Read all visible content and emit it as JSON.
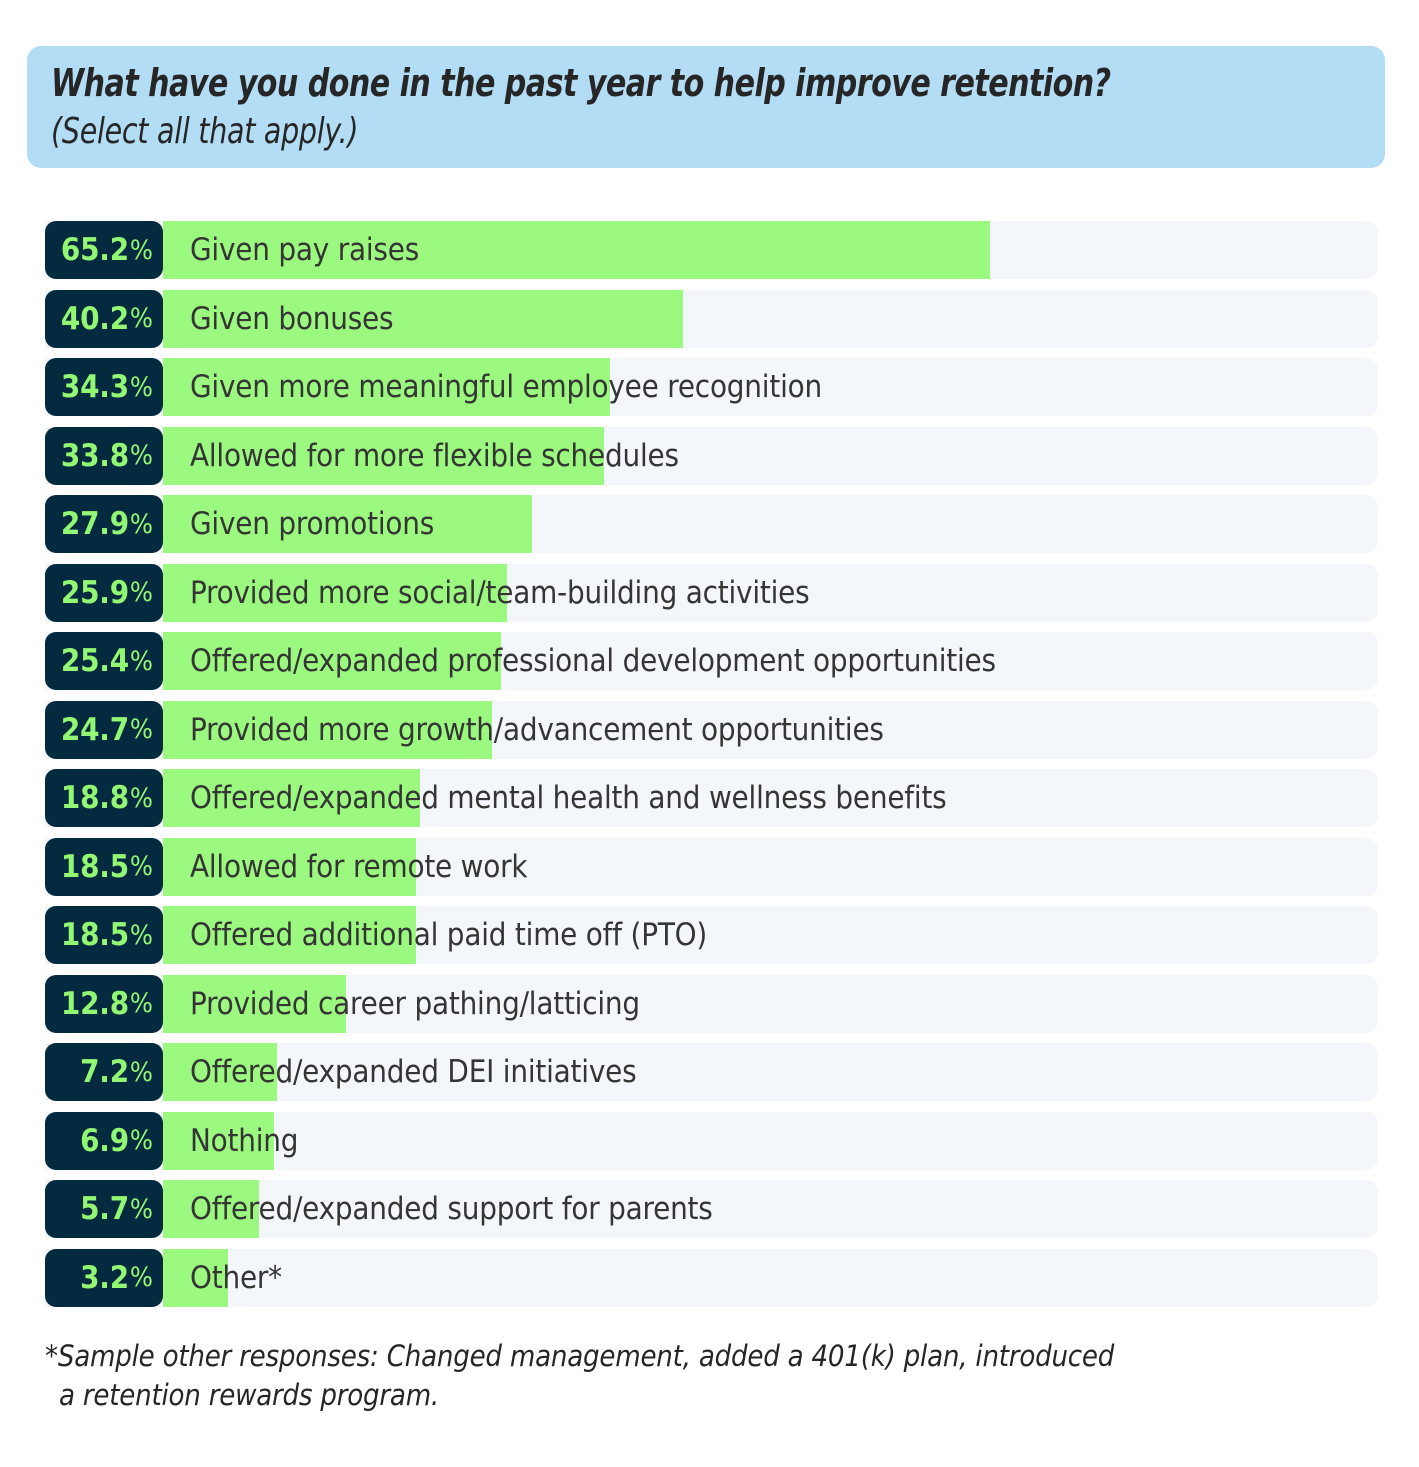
{
  "header": {
    "title": "What have you done in the past year to help improve retention?",
    "subtitle": "(Select all that apply.)",
    "background_color": "#b3dcf5"
  },
  "footnote": {
    "line1": "*Sample other responses: Changed management, added a 401(k) plan, introduced",
    "line2": "a retention rewards program."
  },
  "colors": {
    "bar": "#9cf97f",
    "chip": "#042a40",
    "chip_text": "#92f773",
    "track": "#f3f6fb",
    "label_text": "#353535",
    "header_bg": "#b3dcf5"
  },
  "chart_data": {
    "type": "bar",
    "orientation": "horizontal",
    "title": "What have you done in the past year to help improve retention?",
    "subtitle": "(Select all that apply.)",
    "xlabel": "",
    "ylabel": "",
    "xlim": [
      0,
      100
    ],
    "grid": false,
    "legend": null,
    "value_suffix": "%",
    "categories": [
      "Given pay raises",
      "Given bonuses",
      "Given more meaningful employee recognition",
      "Allowed for more flexible schedules",
      "Given promotions",
      "Provided more social/team-building activities",
      "Offered/expanded professional development opportunities",
      "Provided more growth/advancement opportunities",
      "Offered/expanded mental health and wellness benefits",
      "Allowed for remote work",
      "Offered additional paid time off (PTO)",
      "Provided career pathing/latticing",
      "Offered/expanded DEI initiatives",
      "Nothing",
      "Offered/expanded support for parents",
      "Other*"
    ],
    "values": [
      65.2,
      40.2,
      34.3,
      33.8,
      27.9,
      25.9,
      25.4,
      24.7,
      18.8,
      18.5,
      18.5,
      12.8,
      7.2,
      6.9,
      5.7,
      3.2
    ],
    "value_labels": [
      "65.2%",
      "40.2%",
      "34.3%",
      "33.8%",
      "27.9%",
      "25.9%",
      "25.4%",
      "24.7%",
      "18.8%",
      "18.5%",
      "18.5%",
      "12.8%",
      "7.2%",
      "6.9%",
      "5.7%",
      "3.2%"
    ],
    "annotations": [
      "*Sample other responses: Changed management, added a 401(k) plan, introduced a retention rewards program."
    ]
  }
}
